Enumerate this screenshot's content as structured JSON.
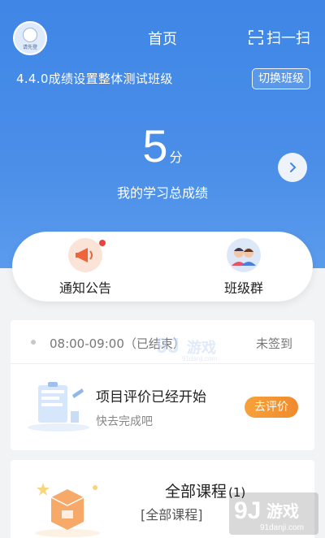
{
  "header": {
    "avatar_caption": "请先登",
    "title": "首页",
    "scan_label": "扫一扫",
    "class_name": "4.4.0成绩设置整体测试班级",
    "switch_label": "切换班级"
  },
  "score": {
    "value": "5",
    "unit": "分",
    "label": "我的学习总成绩"
  },
  "quick": {
    "notice_label": "通知公告",
    "group_label": "班级群"
  },
  "checkin": {
    "time": "08:00-09:00（已结束）",
    "status": "未签到"
  },
  "evaluation": {
    "title": "项目评价已经开始",
    "subtitle": "快去完成吧",
    "button": "去评价"
  },
  "course": {
    "title": "全部课程",
    "count": "(1)",
    "subtitle": "[全部课程]"
  },
  "watermark": {
    "brand": "游戏",
    "domain": "91danji.com",
    "logo_mark": "9J"
  },
  "colors": {
    "hero_blue": "#4a8ee8",
    "accent_orange": "#f08a2e",
    "red_dot": "#e9443f"
  }
}
